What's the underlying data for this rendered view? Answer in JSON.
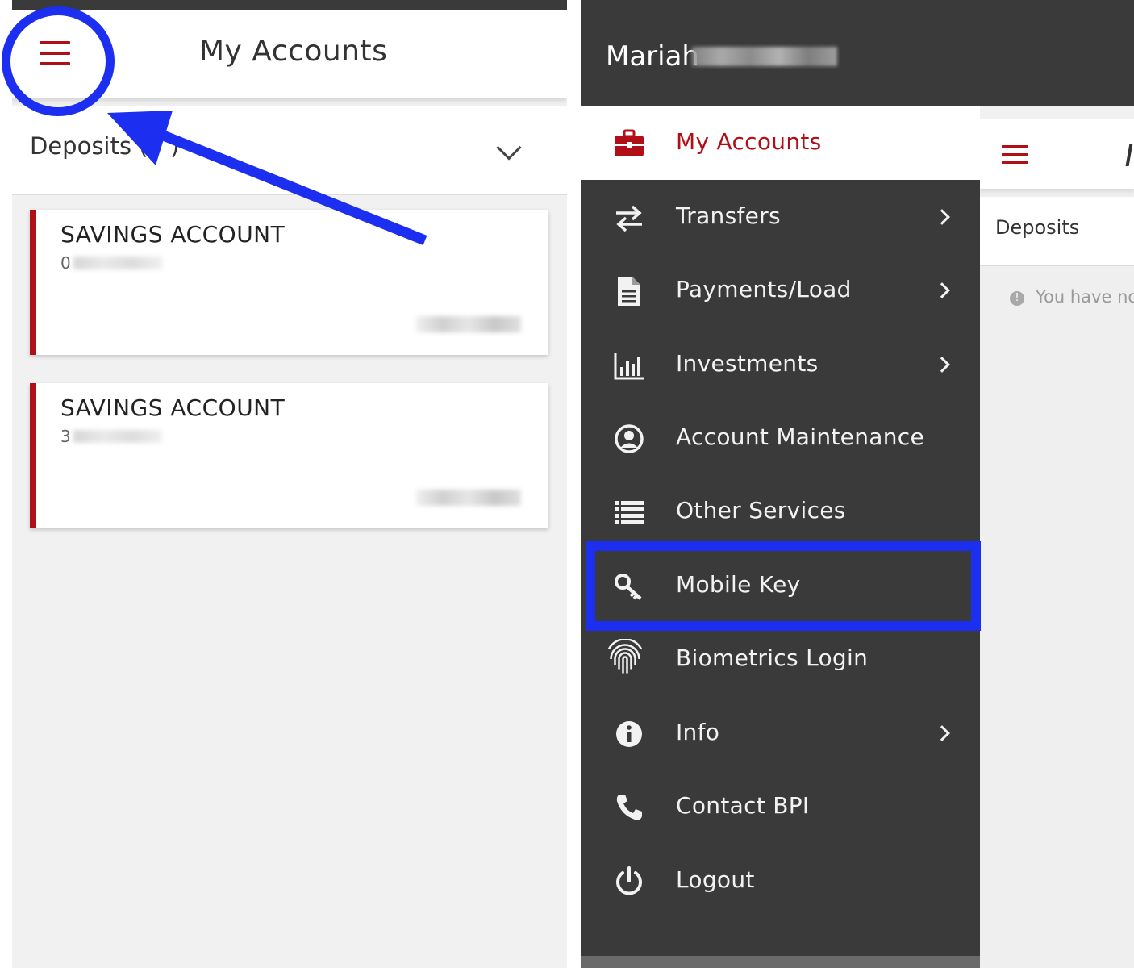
{
  "left_screen": {
    "header": {
      "title": "My Accounts",
      "menu_icon": "hamburger-menu-icon"
    },
    "deposits_section": {
      "label": "Deposits (",
      "label_suffix": ")",
      "toggle_icon": "chevron-down-icon"
    },
    "accounts": [
      {
        "title": "SAVINGS ACCOUNT",
        "number_prefix": "0"
      },
      {
        "title": "SAVINGS ACCOUNT",
        "number_prefix": "3"
      }
    ],
    "annotations": {
      "color": "#1c2ff0"
    }
  },
  "right_screen": {
    "drawer": {
      "user_name": "Mariah",
      "items": [
        {
          "label": "My Accounts",
          "icon": "briefcase-icon",
          "has_submenu": false,
          "active": true
        },
        {
          "label": "Transfers",
          "icon": "transfer-arrows-icon",
          "has_submenu": true
        },
        {
          "label": "Payments/Load",
          "icon": "document-icon",
          "has_submenu": true
        },
        {
          "label": "Investments",
          "icon": "bar-chart-icon",
          "has_submenu": true
        },
        {
          "label": "Account Maintenance",
          "icon": "user-circle-icon",
          "has_submenu": false
        },
        {
          "label": "Other Services",
          "icon": "list-icon",
          "has_submenu": false
        },
        {
          "label": "Mobile Key",
          "icon": "key-icon",
          "has_submenu": false,
          "highlighted": true
        },
        {
          "label": "Biometrics Login",
          "icon": "fingerprint-icon",
          "has_submenu": false
        },
        {
          "label": "Info",
          "icon": "info-icon",
          "has_submenu": true
        },
        {
          "label": "Contact BPI",
          "icon": "phone-icon",
          "has_submenu": false
        },
        {
          "label": "Logout",
          "icon": "power-icon",
          "has_submenu": false
        }
      ]
    },
    "background_app": {
      "deposits_label": "Deposits",
      "notice_text": "You have no",
      "notice_icon": "alert-icon"
    }
  },
  "colors": {
    "brand_red": "#b10f18",
    "drawer_bg": "#3a3a3a",
    "annotation_blue": "#1c2ff0",
    "page_bg": "#f1f1f1"
  }
}
